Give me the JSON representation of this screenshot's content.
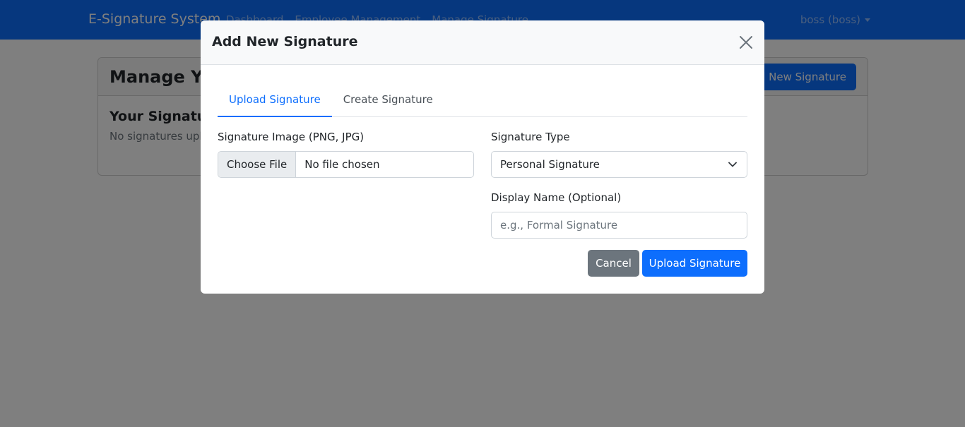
{
  "navbar": {
    "brand": "E-Signature System",
    "links": [
      "Dashboard",
      "Employee Management",
      "Manage Signature"
    ],
    "user": "boss (boss)"
  },
  "page": {
    "title": "Manage Your Signatures",
    "add_button": "Add New Signature",
    "subtitle": "Your Signatures",
    "empty_message": "No signatures uploaded yet."
  },
  "modal": {
    "title": "Add New Signature",
    "tabs": [
      {
        "label": "Upload Signature",
        "active": true
      },
      {
        "label": "Create Signature",
        "active": false
      }
    ],
    "image_label": "Signature Image (PNG, JPG)",
    "file_button": "Choose File",
    "file_status": "No file chosen",
    "type_label": "Signature Type",
    "type_value": "Personal Signature",
    "display_name_label": "Display Name (Optional)",
    "display_name_placeholder": "e.g., Formal Signature",
    "cancel_label": "Cancel",
    "upload_label": "Upload Signature"
  },
  "icons": {
    "close": "close-icon",
    "select_chevron": "chevron-down-icon",
    "user_caret": "caret-down-icon"
  },
  "colors": {
    "primary": "#0d6efd",
    "secondary": "#6c757d",
    "backdrop": "rgba(0,0,0,0.5)"
  }
}
